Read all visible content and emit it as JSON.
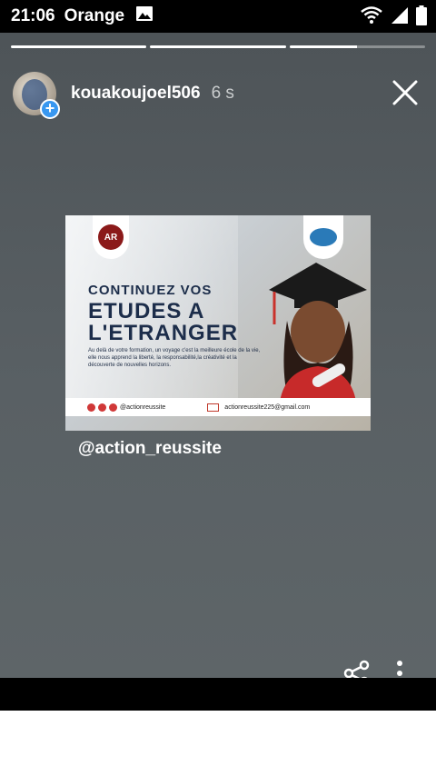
{
  "status_bar": {
    "time": "21:06",
    "carrier": "Orange"
  },
  "story": {
    "progress": [
      1.0,
      1.0,
      0.5
    ],
    "username": "kouakoujoel506",
    "time_ago": "6 s",
    "mention": "@action_reussite",
    "card": {
      "logo_left_text": "AR",
      "title_line1": "CONTINUEZ VOS",
      "title_line2": "ETUDES A",
      "title_line3": "L'ETRANGER",
      "body": "Au delà de votre formation, un voyage c'est la meilleure école de la vie, elle nous apprend la liberté, la responsabilité,la créativité et la découverte de nouvelles horizons.",
      "social_handle": "@actionreussite",
      "email": "actionreussite225@gmail.com"
    }
  },
  "colors": {
    "accent": "#3897f0",
    "story_bg": "#596064",
    "brand_red": "#8b1a1a",
    "brand_navy": "#1c2d4a"
  }
}
